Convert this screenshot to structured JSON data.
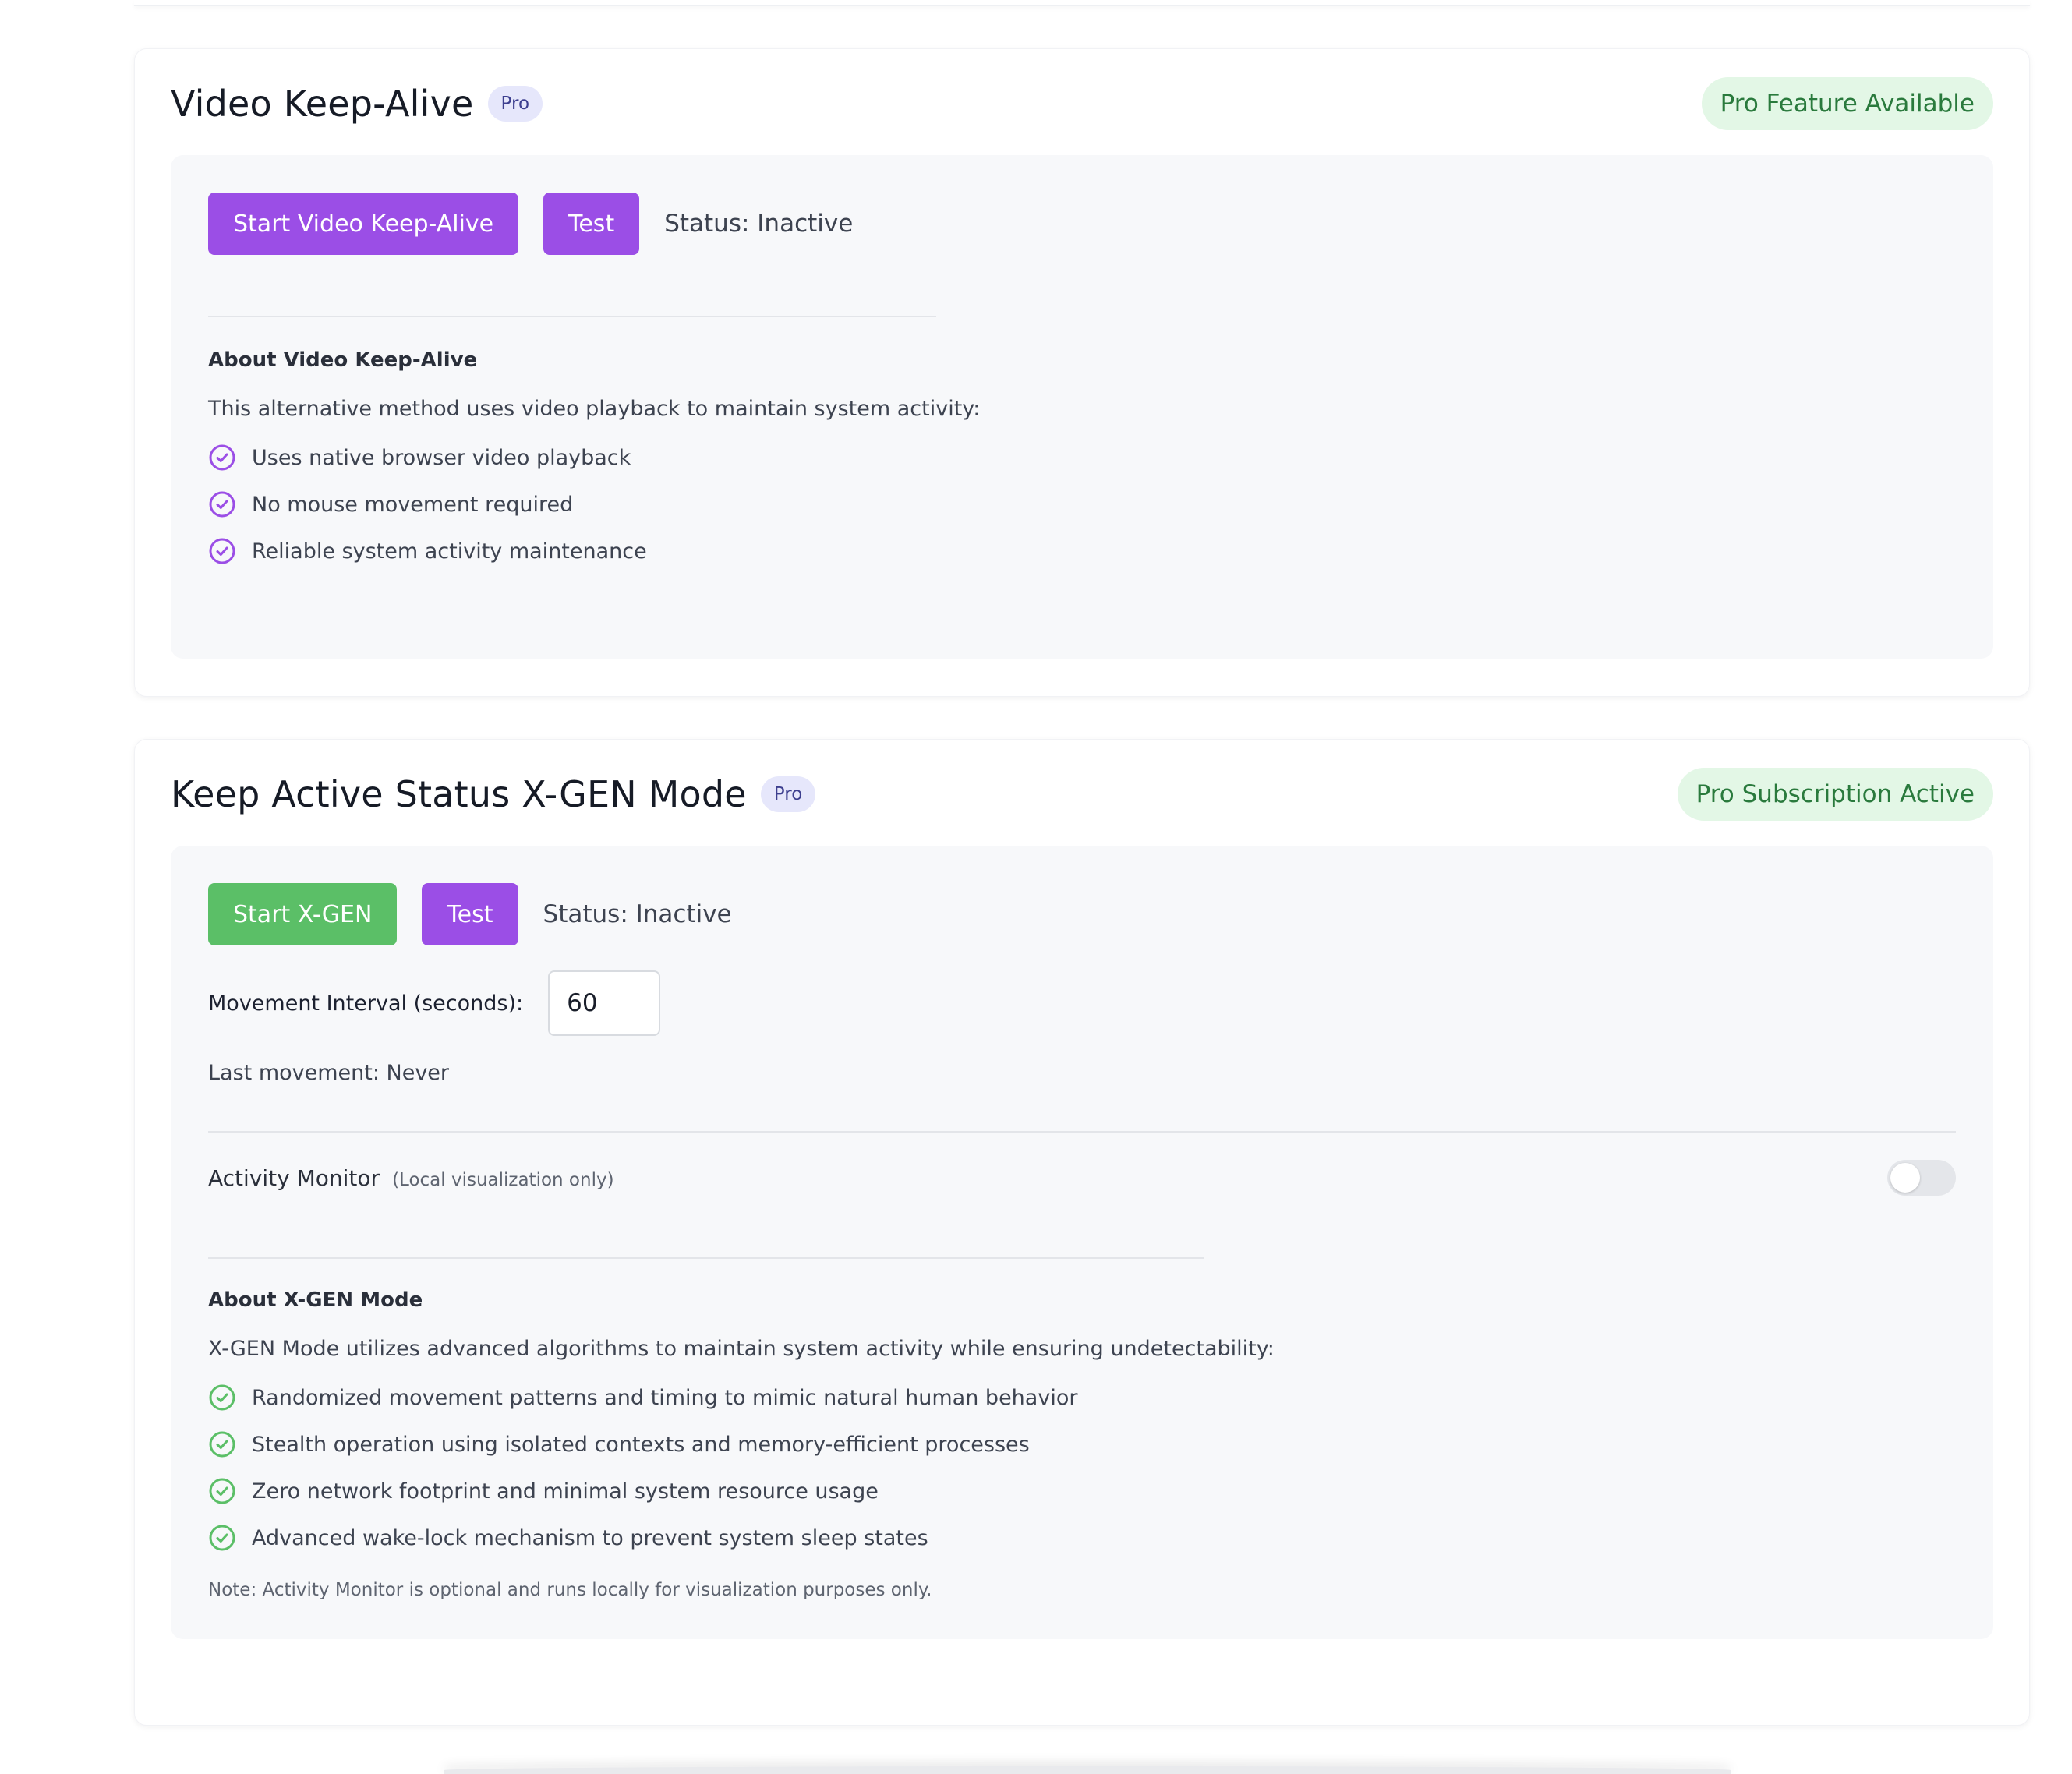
{
  "video_keepalive": {
    "title": "Video Keep-Alive",
    "badge": "Pro",
    "header_status": "Pro Feature Available",
    "start_button": "Start Video Keep-Alive",
    "test_button": "Test",
    "status": "Status: Inactive",
    "about_title": "About Video Keep-Alive",
    "about_desc": "This alternative method uses video playback to maintain system activity:",
    "features": [
      "Uses native browser video playback",
      "No mouse movement required",
      "Reliable system activity maintenance"
    ]
  },
  "xgen": {
    "title": "Keep Active Status X-GEN Mode",
    "badge": "Pro",
    "header_status": "Pro Subscription Active",
    "start_button": "Start X-GEN",
    "test_button": "Test",
    "status": "Status: Inactive",
    "interval_label": "Movement Interval (seconds):",
    "interval_value": "60",
    "last_movement": "Last movement: Never",
    "monitor_label": "Activity Monitor",
    "monitor_note": "(Local visualization only)",
    "monitor_enabled": false,
    "about_title": "About X-GEN Mode",
    "about_desc": "X-GEN Mode utilizes advanced algorithms to maintain system activity while ensuring undetectability:",
    "features": [
      "Randomized movement patterns and timing to mimic natural human behavior",
      "Stealth operation using isolated contexts and memory-efficient processes",
      "Zero network footprint and minimal system resource usage",
      "Advanced wake-lock mechanism to prevent system sleep states"
    ],
    "footnote": "Note: Activity Monitor is optional and runs locally for visualization purposes only."
  },
  "colors": {
    "purple": "#9b4ee6",
    "green": "#5bbf67",
    "pill_bg": "#e3f7e6",
    "pill_text": "#2a7a3d",
    "badge_bg": "#e6e7fb",
    "panel_bg": "#f7f8fa"
  },
  "icons": {
    "feature_check": "check-circle-icon"
  }
}
